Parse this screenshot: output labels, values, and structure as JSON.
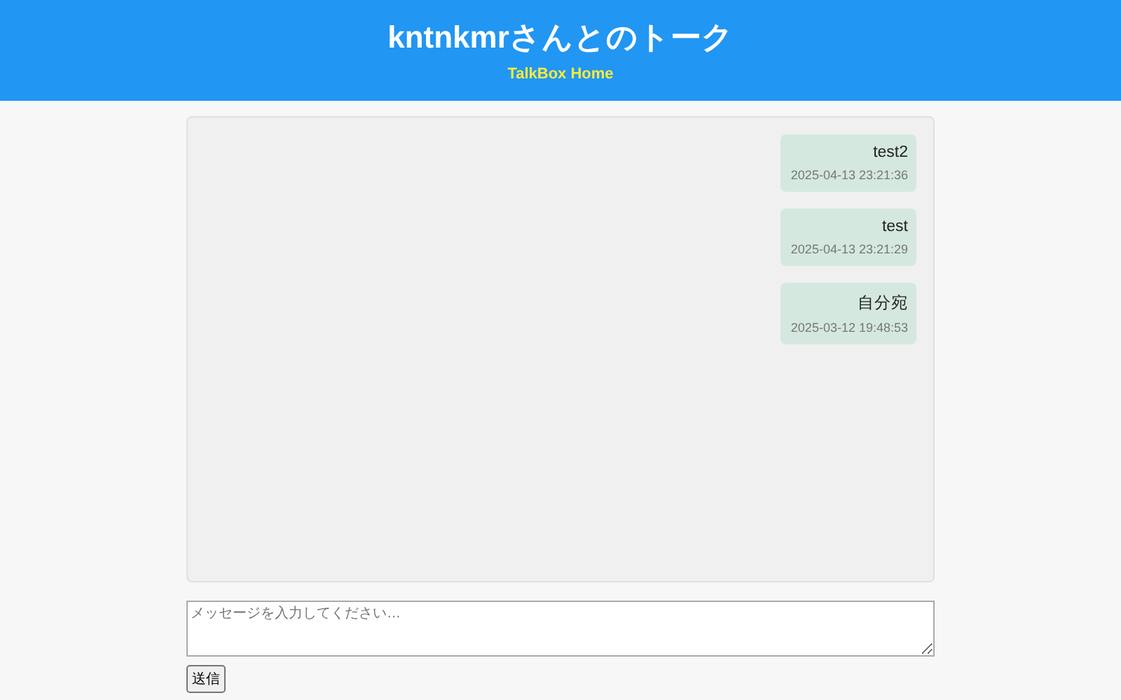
{
  "header": {
    "title": "kntnkmrさんとのトーク",
    "home_link": "TalkBox Home"
  },
  "messages": [
    {
      "text": "test2",
      "time": "2025-04-13 23:21:36"
    },
    {
      "text": "test",
      "time": "2025-04-13 23:21:29"
    },
    {
      "text": "自分宛",
      "time": "2025-03-12 19:48:53"
    }
  ],
  "composer": {
    "placeholder": "メッセージを入力してください…",
    "send_button": "送信"
  }
}
